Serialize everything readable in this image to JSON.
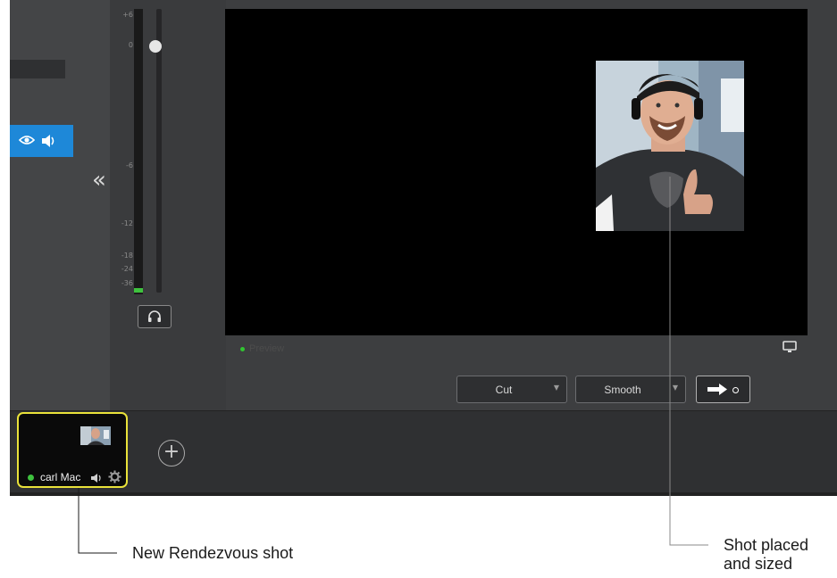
{
  "audio": {
    "db_labels": [
      "+6",
      "0",
      "-6",
      "-12",
      "-18",
      "-24",
      "-36"
    ]
  },
  "preview": {
    "label": "Preview"
  },
  "transitions": {
    "cut_label": "Cut",
    "smooth_label": "Smooth"
  },
  "shots": {
    "items": [
      {
        "name": "carl Mac",
        "active": true
      }
    ]
  },
  "annotations": {
    "new_shot": "New Rendezvous shot",
    "shot_placed_line1": "Shot placed",
    "shot_placed_line2": "and sized"
  },
  "colors": {
    "selection_blue": "#1e88d8",
    "highlight_yellow": "#e9e23a",
    "live_green": "#3ec23e"
  }
}
